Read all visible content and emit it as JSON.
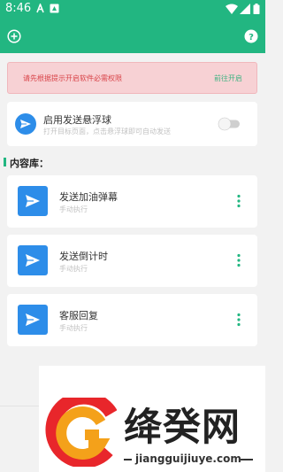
{
  "status_bar": {
    "time": "8:46",
    "icons": [
      "notification-a-icon",
      "notification-box-icon",
      "wifi-icon",
      "signal-icon",
      "battery-icon"
    ]
  },
  "app_bar": {
    "left_icon": "add-circle-icon",
    "right_icon": "help-icon",
    "color": "#22b681"
  },
  "banner": {
    "message": "请先根据提示开启软件必需权限",
    "action": "前往开启",
    "text_color": "#d9454a",
    "bg_color": "#f7d1d4"
  },
  "floating_ball": {
    "title": "启用发送悬浮球",
    "subtitle": "打开目标页面，点击悬浮球即可自动发送",
    "enabled": false
  },
  "content": {
    "section_title": "内容库：",
    "items": [
      {
        "title": "发送加油弹幕",
        "subtitle": "手动执行"
      },
      {
        "title": "发送倒计时",
        "subtitle": "手动执行"
      },
      {
        "title": "客服回复",
        "subtitle": "手动执行"
      }
    ]
  },
  "watermark": {
    "name": "绛癸网",
    "url": "jiangguijiuye.com"
  }
}
